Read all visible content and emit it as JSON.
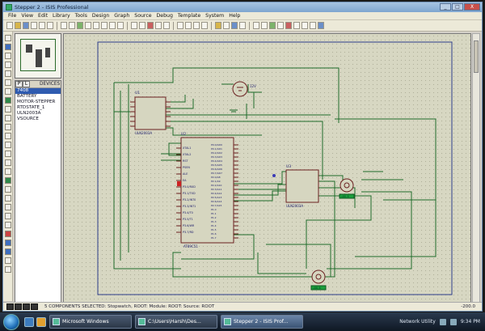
{
  "window": {
    "title": "Stepper 2 - ISIS Professional",
    "controls": [
      "_",
      "□",
      "X"
    ]
  },
  "menu": [
    "File",
    "View",
    "Edit",
    "Library",
    "Tools",
    "Design",
    "Graph",
    "Source",
    "Debug",
    "Template",
    "System",
    "Help"
  ],
  "device_panel": {
    "mode_p": "P",
    "mode_l": "L",
    "header": "DEVICES",
    "items": [
      "7408",
      "BATTERY",
      "MOTOR-STEPPER",
      "RTDSTATE_1",
      "ULN2003A",
      "VSOURCE"
    ],
    "selected_index": 0
  },
  "schematic": {
    "u1": {
      "ref": "U1",
      "part": "ULN2003A"
    },
    "u2": {
      "ref": "U2",
      "part": "AT89C51"
    },
    "u3": {
      "ref": "U3",
      "part": "ULN2003A"
    },
    "battery": {
      "value": "12V"
    },
    "u2_left_pins": [
      "XTAL1",
      "XTAL2",
      "RST",
      "PSEN",
      "ALE",
      "EA",
      "P3.0/RXD",
      "P3.1/TXD",
      "P3.2/INT0",
      "P3.3/INT1",
      "P3.4/T0",
      "P3.5/T1",
      "P3.6/WR",
      "P3.7/RD"
    ],
    "u2_right_pins": [
      "P0.0/AD0",
      "P0.1/AD1",
      "P0.2/AD2",
      "P0.3/AD3",
      "P0.4/AD4",
      "P0.5/AD5",
      "P0.6/AD6",
      "P0.7/AD7",
      "P2.0/A8",
      "P2.1/A9",
      "P2.2/A10",
      "P2.3/A11",
      "P2.4/A12",
      "P2.5/A13",
      "P2.6/A14",
      "P2.7/A15",
      "P1.0",
      "P1.1",
      "P1.2",
      "P1.3",
      "P1.4",
      "P1.5",
      "P1.6",
      "P1.7"
    ],
    "motor1_label": "+88.8",
    "motor2_label": "+88.8"
  },
  "statusbar": {
    "message": "5 COMPONENTS SELECTED: Stopwatch, ROOT: Module: ROOT: Source: ROOT",
    "coords": "-200.0"
  },
  "taskbar": {
    "tasks": [
      {
        "label": "Microsoft Windows",
        "active": false
      },
      {
        "label": "C:\\Users\\Harsh\\Des...",
        "active": false
      },
      {
        "label": "Stepper 2 - ISIS Prof...",
        "active": true
      }
    ],
    "tray_text": "Network Utility",
    "clock": "9:34 PM"
  }
}
